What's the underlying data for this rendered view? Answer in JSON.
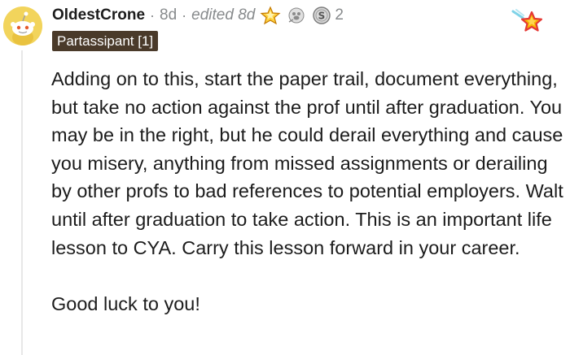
{
  "comment": {
    "username": "OldestCrone",
    "separator": "·",
    "age": "8d",
    "edited": "edited 8d",
    "award_count": "2",
    "flair": "Partassipant [1]",
    "icons": {
      "avatar": "snoo-avatar-icon",
      "award_1": "star-award-icon",
      "award_2": "paw-award-icon",
      "award_3": "silver-coin-award-icon",
      "corner": "star-badge-icon"
    },
    "paragraphs": [
      "Adding on to this, start the paper trail, document everything, but take no action against the prof until after graduation. You may be in the right, but he could derail everything and cause you misery, anything from missed assignments or derailing by other profs to bad references to potential employers. Walt until after graduation to take action. This is an important life lesson to CYA. Carry this lesson forward in your career.",
      "Good luck to you!"
    ]
  },
  "colors": {
    "flair_bg": "#4a3a2a",
    "meta_text": "#878a8c",
    "avatar_bg": "#f2d45c",
    "star_gold": "#f7b500",
    "star_red": "#e53935"
  }
}
